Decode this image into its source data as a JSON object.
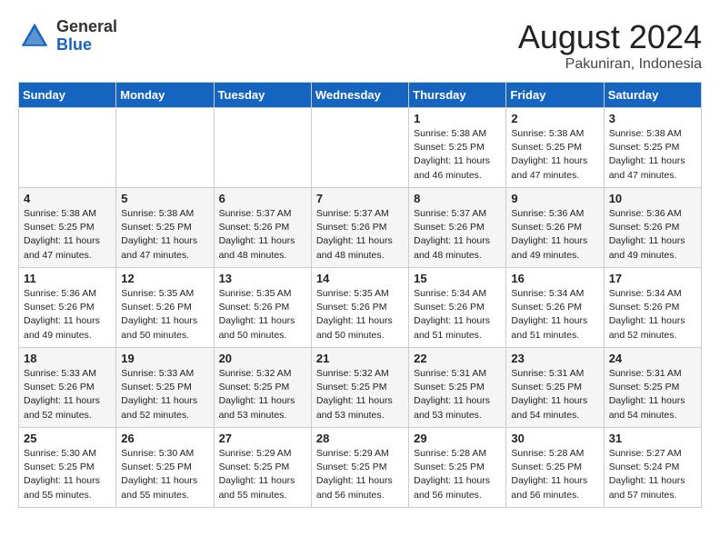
{
  "header": {
    "logo_general": "General",
    "logo_blue": "Blue",
    "month_year": "August 2024",
    "location": "Pakuniran, Indonesia"
  },
  "weekdays": [
    "Sunday",
    "Monday",
    "Tuesday",
    "Wednesday",
    "Thursday",
    "Friday",
    "Saturday"
  ],
  "weeks": [
    [
      {
        "day": "",
        "sunrise": "",
        "sunset": "",
        "daylight": ""
      },
      {
        "day": "",
        "sunrise": "",
        "sunset": "",
        "daylight": ""
      },
      {
        "day": "",
        "sunrise": "",
        "sunset": "",
        "daylight": ""
      },
      {
        "day": "",
        "sunrise": "",
        "sunset": "",
        "daylight": ""
      },
      {
        "day": "1",
        "sunrise": "Sunrise: 5:38 AM",
        "sunset": "Sunset: 5:25 PM",
        "daylight": "Daylight: 11 hours and 46 minutes."
      },
      {
        "day": "2",
        "sunrise": "Sunrise: 5:38 AM",
        "sunset": "Sunset: 5:25 PM",
        "daylight": "Daylight: 11 hours and 47 minutes."
      },
      {
        "day": "3",
        "sunrise": "Sunrise: 5:38 AM",
        "sunset": "Sunset: 5:25 PM",
        "daylight": "Daylight: 11 hours and 47 minutes."
      }
    ],
    [
      {
        "day": "4",
        "sunrise": "Sunrise: 5:38 AM",
        "sunset": "Sunset: 5:25 PM",
        "daylight": "Daylight: 11 hours and 47 minutes."
      },
      {
        "day": "5",
        "sunrise": "Sunrise: 5:38 AM",
        "sunset": "Sunset: 5:25 PM",
        "daylight": "Daylight: 11 hours and 47 minutes."
      },
      {
        "day": "6",
        "sunrise": "Sunrise: 5:37 AM",
        "sunset": "Sunset: 5:26 PM",
        "daylight": "Daylight: 11 hours and 48 minutes."
      },
      {
        "day": "7",
        "sunrise": "Sunrise: 5:37 AM",
        "sunset": "Sunset: 5:26 PM",
        "daylight": "Daylight: 11 hours and 48 minutes."
      },
      {
        "day": "8",
        "sunrise": "Sunrise: 5:37 AM",
        "sunset": "Sunset: 5:26 PM",
        "daylight": "Daylight: 11 hours and 48 minutes."
      },
      {
        "day": "9",
        "sunrise": "Sunrise: 5:36 AM",
        "sunset": "Sunset: 5:26 PM",
        "daylight": "Daylight: 11 hours and 49 minutes."
      },
      {
        "day": "10",
        "sunrise": "Sunrise: 5:36 AM",
        "sunset": "Sunset: 5:26 PM",
        "daylight": "Daylight: 11 hours and 49 minutes."
      }
    ],
    [
      {
        "day": "11",
        "sunrise": "Sunrise: 5:36 AM",
        "sunset": "Sunset: 5:26 PM",
        "daylight": "Daylight: 11 hours and 49 minutes."
      },
      {
        "day": "12",
        "sunrise": "Sunrise: 5:35 AM",
        "sunset": "Sunset: 5:26 PM",
        "daylight": "Daylight: 11 hours and 50 minutes."
      },
      {
        "day": "13",
        "sunrise": "Sunrise: 5:35 AM",
        "sunset": "Sunset: 5:26 PM",
        "daylight": "Daylight: 11 hours and 50 minutes."
      },
      {
        "day": "14",
        "sunrise": "Sunrise: 5:35 AM",
        "sunset": "Sunset: 5:26 PM",
        "daylight": "Daylight: 11 hours and 50 minutes."
      },
      {
        "day": "15",
        "sunrise": "Sunrise: 5:34 AM",
        "sunset": "Sunset: 5:26 PM",
        "daylight": "Daylight: 11 hours and 51 minutes."
      },
      {
        "day": "16",
        "sunrise": "Sunrise: 5:34 AM",
        "sunset": "Sunset: 5:26 PM",
        "daylight": "Daylight: 11 hours and 51 minutes."
      },
      {
        "day": "17",
        "sunrise": "Sunrise: 5:34 AM",
        "sunset": "Sunset: 5:26 PM",
        "daylight": "Daylight: 11 hours and 52 minutes."
      }
    ],
    [
      {
        "day": "18",
        "sunrise": "Sunrise: 5:33 AM",
        "sunset": "Sunset: 5:26 PM",
        "daylight": "Daylight: 11 hours and 52 minutes."
      },
      {
        "day": "19",
        "sunrise": "Sunrise: 5:33 AM",
        "sunset": "Sunset: 5:25 PM",
        "daylight": "Daylight: 11 hours and 52 minutes."
      },
      {
        "day": "20",
        "sunrise": "Sunrise: 5:32 AM",
        "sunset": "Sunset: 5:25 PM",
        "daylight": "Daylight: 11 hours and 53 minutes."
      },
      {
        "day": "21",
        "sunrise": "Sunrise: 5:32 AM",
        "sunset": "Sunset: 5:25 PM",
        "daylight": "Daylight: 11 hours and 53 minutes."
      },
      {
        "day": "22",
        "sunrise": "Sunrise: 5:31 AM",
        "sunset": "Sunset: 5:25 PM",
        "daylight": "Daylight: 11 hours and 53 minutes."
      },
      {
        "day": "23",
        "sunrise": "Sunrise: 5:31 AM",
        "sunset": "Sunset: 5:25 PM",
        "daylight": "Daylight: 11 hours and 54 minutes."
      },
      {
        "day": "24",
        "sunrise": "Sunrise: 5:31 AM",
        "sunset": "Sunset: 5:25 PM",
        "daylight": "Daylight: 11 hours and 54 minutes."
      }
    ],
    [
      {
        "day": "25",
        "sunrise": "Sunrise: 5:30 AM",
        "sunset": "Sunset: 5:25 PM",
        "daylight": "Daylight: 11 hours and 55 minutes."
      },
      {
        "day": "26",
        "sunrise": "Sunrise: 5:30 AM",
        "sunset": "Sunset: 5:25 PM",
        "daylight": "Daylight: 11 hours and 55 minutes."
      },
      {
        "day": "27",
        "sunrise": "Sunrise: 5:29 AM",
        "sunset": "Sunset: 5:25 PM",
        "daylight": "Daylight: 11 hours and 55 minutes."
      },
      {
        "day": "28",
        "sunrise": "Sunrise: 5:29 AM",
        "sunset": "Sunset: 5:25 PM",
        "daylight": "Daylight: 11 hours and 56 minutes."
      },
      {
        "day": "29",
        "sunrise": "Sunrise: 5:28 AM",
        "sunset": "Sunset: 5:25 PM",
        "daylight": "Daylight: 11 hours and 56 minutes."
      },
      {
        "day": "30",
        "sunrise": "Sunrise: 5:28 AM",
        "sunset": "Sunset: 5:25 PM",
        "daylight": "Daylight: 11 hours and 56 minutes."
      },
      {
        "day": "31",
        "sunrise": "Sunrise: 5:27 AM",
        "sunset": "Sunset: 5:24 PM",
        "daylight": "Daylight: 11 hours and 57 minutes."
      }
    ]
  ]
}
